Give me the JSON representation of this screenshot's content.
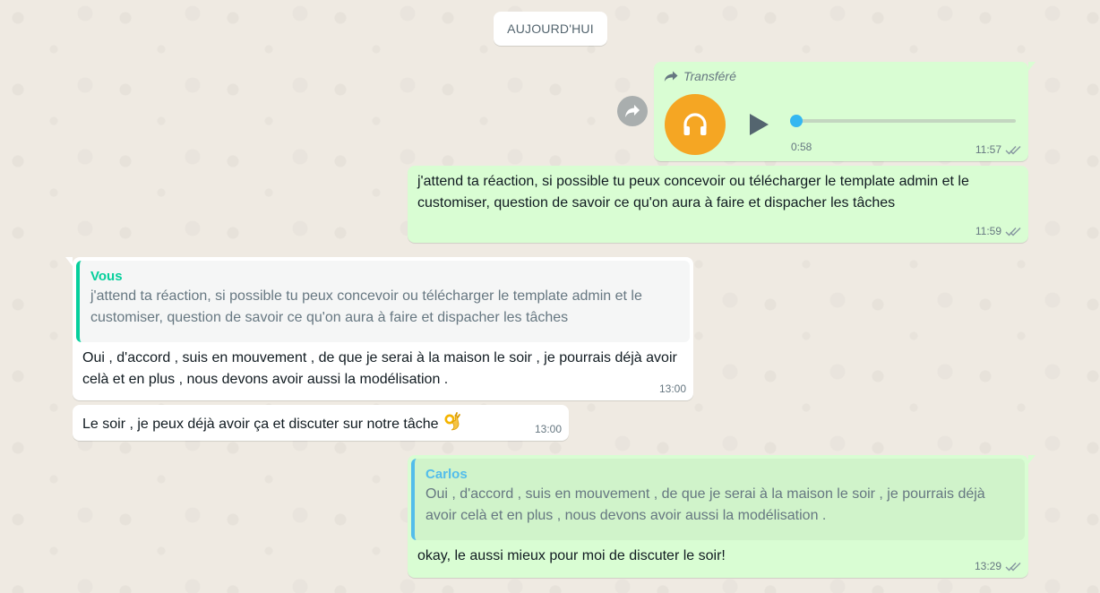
{
  "date_separator": "AUJOURD'HUI",
  "messages": {
    "audio": {
      "forwarded_label": "Transféré",
      "duration": "0:58",
      "progress": 0.0,
      "time": "11:57"
    },
    "msg1": {
      "text": "j'attend ta réaction, si possible tu peux concevoir ou télécharger le template admin et le customiser, question de savoir ce qu'on aura à faire et dispacher les tâches",
      "time": "11:59"
    },
    "msg2": {
      "quote_author": "Vous",
      "quote_text": "j'attend ta réaction, si possible tu peux concevoir ou télécharger le template admin et le customiser, question de savoir ce qu'on aura à faire et dispacher les tâches",
      "text": "Oui , d'accord , suis en mouvement , de que je serai à la maison le soir , je pourrais déjà avoir celà et en plus , nous devons avoir aussi la modélisation .",
      "time": "13:00"
    },
    "msg3": {
      "text": "Le soir , je peux déjà avoir ça et discuter sur notre tâche",
      "emoji": "ok-hand",
      "time": "13:00"
    },
    "msg4": {
      "quote_author": "Carlos",
      "quote_text": "Oui , d'accord , suis en mouvement , de que je serai à la maison le soir , je pourrais déjà avoir celà et en plus , nous devons avoir aussi la modélisation .",
      "text": "okay, le aussi mieux pour moi de discuter le soir!",
      "time": "13:29"
    }
  },
  "colors": {
    "outgoing_bubble": "#d9fdd3",
    "incoming_bubble": "#ffffff",
    "quote_you": "#06cf9c",
    "quote_carlos": "#53bdeb",
    "audio_avatar": "#f5a623",
    "read_ticks": "#8696a0"
  }
}
